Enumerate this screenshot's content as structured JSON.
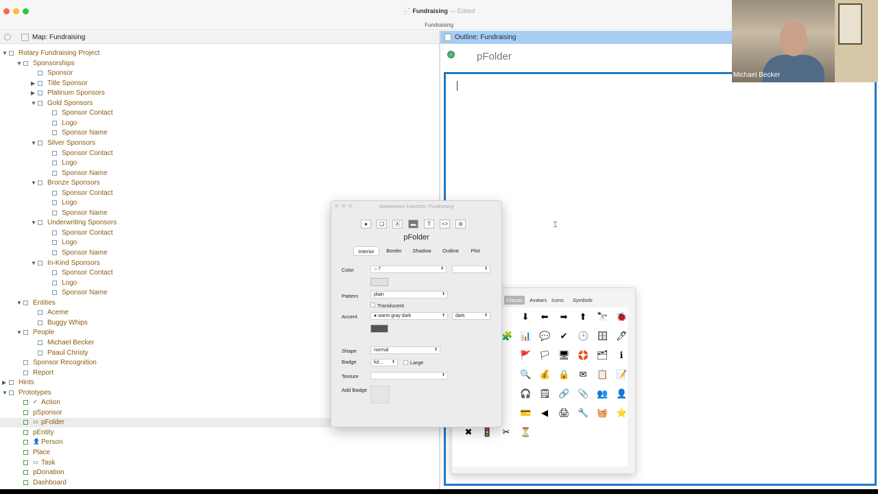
{
  "window": {
    "title": "Fundraising",
    "status": "Edited",
    "separator": "—",
    "toolbar_label": "Fundraising"
  },
  "map": {
    "header": "Map: Fundraising"
  },
  "outline": {
    "header": "Outline: Fundraising",
    "node_title": "pFolder"
  },
  "video": {
    "name": "Michael Becker"
  },
  "tree": [
    {
      "label": "Rotary Fundraising Project",
      "level": 0,
      "toggle": "▼"
    },
    {
      "label": "Sponsorships",
      "level": 1,
      "toggle": "▼"
    },
    {
      "label": "Sponsor",
      "level": 2,
      "toggle": ""
    },
    {
      "label": "Title Sponsor",
      "level": 2,
      "toggle": "▶"
    },
    {
      "label": "Platinum Sponsors",
      "level": 2,
      "toggle": "▶"
    },
    {
      "label": "Gold Sponsors",
      "level": 2,
      "toggle": "▼"
    },
    {
      "label": "Sponsor Contact",
      "level": 3,
      "toggle": ""
    },
    {
      "label": "Logo",
      "level": 3,
      "toggle": ""
    },
    {
      "label": "Sponsor Name",
      "level": 3,
      "toggle": ""
    },
    {
      "label": "Silver Sponsors",
      "level": 2,
      "toggle": "▼"
    },
    {
      "label": "Sponsor Contact",
      "level": 3,
      "toggle": ""
    },
    {
      "label": "Logo",
      "level": 3,
      "toggle": ""
    },
    {
      "label": "Sponsor Name",
      "level": 3,
      "toggle": ""
    },
    {
      "label": "Bronze Sponsors",
      "level": 2,
      "toggle": "▼"
    },
    {
      "label": "Sponsor Contact",
      "level": 3,
      "toggle": ""
    },
    {
      "label": "Logo",
      "level": 3,
      "toggle": ""
    },
    {
      "label": "Sponsor Name",
      "level": 3,
      "toggle": ""
    },
    {
      "label": "Underwriting Sponsors",
      "level": 2,
      "toggle": "▼"
    },
    {
      "label": "Sponsor Contact",
      "level": 3,
      "toggle": ""
    },
    {
      "label": "Logo",
      "level": 3,
      "toggle": ""
    },
    {
      "label": "Sponsor Name",
      "level": 3,
      "toggle": ""
    },
    {
      "label": "In-Kind Sponsors",
      "level": 2,
      "toggle": "▼"
    },
    {
      "label": "Sponsor Contact",
      "level": 3,
      "toggle": ""
    },
    {
      "label": "Logo",
      "level": 3,
      "toggle": ""
    },
    {
      "label": "Sponsor Name",
      "level": 3,
      "toggle": ""
    },
    {
      "label": "Entities",
      "level": 1,
      "toggle": "▼"
    },
    {
      "label": "Aceme",
      "level": 2,
      "toggle": ""
    },
    {
      "label": "Buggy Whips",
      "level": 2,
      "toggle": ""
    },
    {
      "label": "People",
      "level": 1,
      "toggle": "▼"
    },
    {
      "label": "Michael Becker",
      "level": 2,
      "toggle": ""
    },
    {
      "label": "Paaul Christy",
      "level": 2,
      "toggle": ""
    },
    {
      "label": "Sponsor Recognition",
      "level": 1,
      "toggle": ""
    },
    {
      "label": "Report",
      "level": 1,
      "toggle": ""
    },
    {
      "label": "Hints",
      "level": 0,
      "toggle": "▶"
    },
    {
      "label": "Prototypes",
      "level": 0,
      "toggle": "▼"
    },
    {
      "label": "Action",
      "level": 1,
      "toggle": "",
      "proto": "✓"
    },
    {
      "label": "pSponsor",
      "level": 1,
      "toggle": ""
    },
    {
      "label": "pFolder",
      "level": 1,
      "toggle": "",
      "proto": "▭",
      "selected": true
    },
    {
      "label": "pEntity",
      "level": 1,
      "toggle": ""
    },
    {
      "label": "Person",
      "level": 1,
      "toggle": "",
      "proto": "👤"
    },
    {
      "label": "Place",
      "level": 1,
      "toggle": ""
    },
    {
      "label": "Task",
      "level": 1,
      "toggle": "",
      "proto": "▭"
    },
    {
      "label": "pDonation",
      "level": 1,
      "toggle": ""
    },
    {
      "label": "Dashboard",
      "level": 1,
      "toggle": ""
    }
  ],
  "inspector": {
    "title": "Appearance Inspector: Fundraising",
    "node": "pFolder",
    "tools": [
      "●",
      "❏",
      "🄰",
      "▬",
      "T",
      "<>",
      "⊖"
    ],
    "tabs": [
      "Interior",
      "Border",
      "Shadow",
      "Outline",
      "Plot"
    ],
    "color_label": "Color",
    "color_value": "7",
    "pattern_label": "Pattern",
    "pattern_value": "plain",
    "translucent_label": "Translucent",
    "accent_label": "Accent",
    "accent_value": "warm gray dark",
    "accent_shade": "dark",
    "shape_label": "Shape",
    "shape_value": "normal",
    "badge_label": "Badge",
    "badge_value": "fol...",
    "large_label": "Large",
    "texture_label": "Texture",
    "add_badge_label": "Add Badge",
    "colors": {
      "accent_swatch": "#555555",
      "color_swatch": "#e0e0e0"
    }
  },
  "badges": {
    "tabs": [
      "Classic",
      "Avatars",
      "Icons",
      "Symbols"
    ],
    "active_tab": "Classic",
    "icons": [
      "⬇",
      "⬅",
      "➡",
      "⬆",
      "🔭",
      "🐞",
      "🧩",
      "📊",
      "💬",
      "✔",
      "🕒",
      "🗄",
      "🖊",
      "🚩",
      "🏳",
      "🖥",
      "🛟",
      "🗂",
      "ℹ",
      "🔍",
      "💰",
      "🔒",
      "✉",
      "📋",
      "📝",
      "🎧",
      "🗒",
      "🔗",
      "📎",
      "👥",
      "👤",
      "💳",
      "◀",
      "🖨",
      "🔧",
      "🧺",
      "⭐",
      "✖",
      "🚦",
      "✂",
      "⏳",
      "⚠",
      "🌐",
      "🏠",
      "✖"
    ],
    "colors": {
      "classic_tab": "#b5b5b5"
    }
  }
}
